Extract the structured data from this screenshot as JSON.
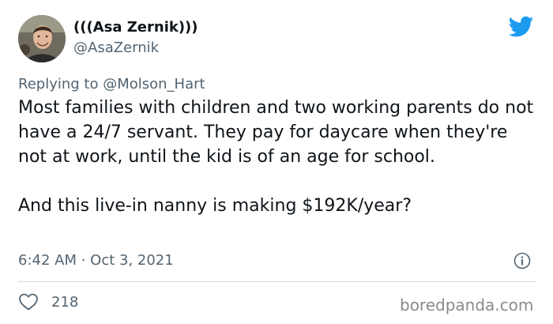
{
  "author": {
    "display_name": "(((Asa Zernik)))",
    "handle": "@AsaZernik"
  },
  "reply": {
    "prefix": "Replying to ",
    "mention": "@Molson_Hart"
  },
  "tweet": {
    "text": "Most families with children and two working parents do not have a 24/7 servant. They pay for daycare when they're not at work, until the kid is of an age for school.\n\nAnd this live-in nanny is making $192K/year?",
    "timestamp": "6:42 AM · Oct 3, 2021"
  },
  "actions": {
    "like_count": "218"
  },
  "watermark": "boredpanda.com",
  "icons": {
    "brand": "twitter-bird-icon",
    "info": "info-icon",
    "like": "heart-icon"
  },
  "colors": {
    "twitter_blue": "#1d9bf0",
    "secondary_text": "#536471",
    "primary_text": "#0f1419",
    "divider": "#cfd9de"
  }
}
